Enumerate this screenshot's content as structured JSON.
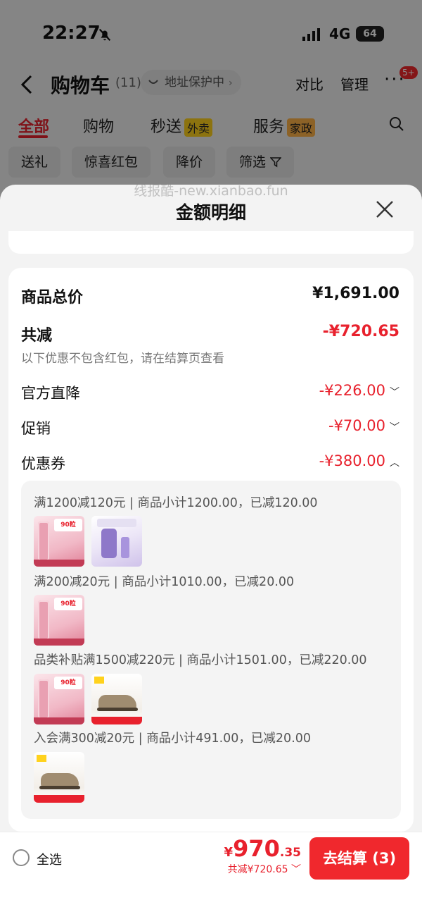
{
  "status_bar": {
    "time": "22:27",
    "network": "4G",
    "battery": "64"
  },
  "cart_header": {
    "title": "购物车",
    "count": "(11)",
    "address_protect": "地址保护中",
    "compare": "对比",
    "manage": "管理",
    "more_badge": "5+"
  },
  "tabs": [
    {
      "label": "全部"
    },
    {
      "label": "购物"
    },
    {
      "label": "秒送",
      "tag": "外卖"
    },
    {
      "label": "服务",
      "tag": "家政"
    }
  ],
  "chips": [
    {
      "label": "送礼"
    },
    {
      "label": "惊喜红包"
    },
    {
      "label": "降价"
    },
    {
      "label": "筛选"
    }
  ],
  "sheet": {
    "watermark": "线报酷-new.xianbao.fun",
    "title": "金额明细"
  },
  "detail": {
    "goods_total_label": "商品总价",
    "goods_total_value": "¥1,691.00",
    "total_discount_label": "共减",
    "total_discount_value": "-¥720.65",
    "note": "以下优惠不包含红包，请在结算页查看",
    "rows": [
      {
        "label": "官方直降",
        "value": "-¥226.00",
        "expanded": false
      },
      {
        "label": "促销",
        "value": "-¥70.00",
        "expanded": false
      },
      {
        "label": "优惠券",
        "value": "-¥380.00",
        "expanded": true
      }
    ],
    "coupons": [
      {
        "text": "满1200减120元 | 商品小计1200.00，已减120.00",
        "thumbs": [
          "serum",
          "purple"
        ]
      },
      {
        "text": "满200减20元 | 商品小计1010.00，已减20.00",
        "thumbs": [
          "serum"
        ]
      },
      {
        "text": "品类补贴满1500减220元 | 商品小计1501.00，已减220.00",
        "thumbs": [
          "serum",
          "shoe"
        ]
      },
      {
        "text": "入会满300减20元 | 商品小计491.00，已减20.00",
        "thumbs": [
          "shoe"
        ]
      }
    ]
  },
  "checkout": {
    "select_all": "全选",
    "currency": "¥",
    "total_int": "970",
    "total_dec": ".35",
    "saved": "共减¥720.65",
    "button": "去结算 (3)"
  },
  "colors": {
    "accent": "#e8212d",
    "sheet_bg": "#f3f3f3",
    "card_bg": "#ffffff"
  }
}
